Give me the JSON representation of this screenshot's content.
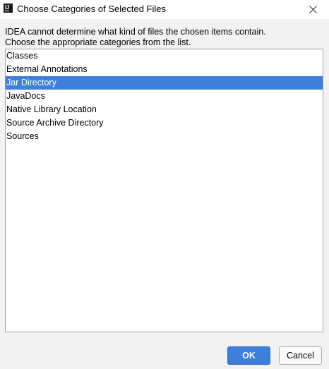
{
  "window": {
    "title": "Choose Categories of Selected Files",
    "app_icon_text": "IJ"
  },
  "message": {
    "line1": "IDEA cannot determine what kind of files the chosen items contain.",
    "line2": "Choose the appropriate categories from the list."
  },
  "categories": {
    "items": [
      {
        "label": "Classes"
      },
      {
        "label": "External Annotations"
      },
      {
        "label": "Jar Directory"
      },
      {
        "label": "JavaDocs"
      },
      {
        "label": "Native Library Location"
      },
      {
        "label": "Source Archive Directory"
      },
      {
        "label": "Sources"
      }
    ],
    "selected_label": "Jar Directory"
  },
  "buttons": {
    "ok_label": "OK",
    "cancel_label": "Cancel"
  },
  "colors": {
    "selection": "#3d7fd9",
    "primary_button": "#3d7fd9"
  },
  "icons": {
    "app": "intellij-idea-icon",
    "close": "close-icon"
  }
}
